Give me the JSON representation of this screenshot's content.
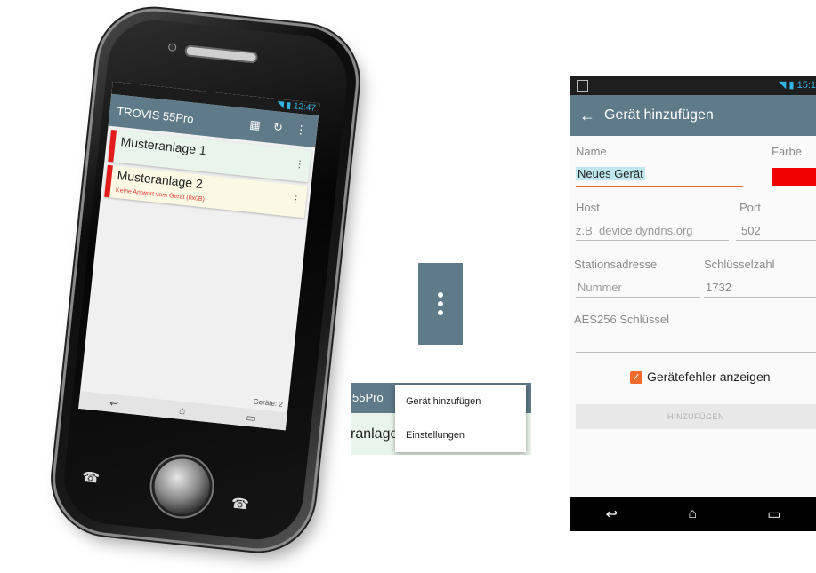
{
  "phone": {
    "status_time": "12:47",
    "app_title": "TROVIS 55Pro",
    "devices": [
      {
        "name": "Musteranlage 1",
        "error": "",
        "bg": "#e9f5ea"
      },
      {
        "name": "Musteranlage 2",
        "error": "Keine Antwort vom Gerät (0x0B)",
        "bg": "#fbf9e4"
      }
    ],
    "device_count": "Geräte: 2"
  },
  "menu_crop": {
    "app_title_fragment": "55Pro",
    "card_fragment": "ranlage",
    "items": [
      "Gerät hinzufügen",
      "Einstellungen"
    ]
  },
  "add_device": {
    "status_time": "15:1",
    "title": "Gerät hinzufügen",
    "name_label": "Name",
    "name_value": "Neues Gerät",
    "color_label": "Farbe",
    "color_value": "#f00000",
    "host_label": "Host",
    "host_placeholder": "z.B. device.dyndns.org",
    "port_label": "Port",
    "port_value": "502",
    "station_label": "Stationsadresse",
    "station_placeholder": "Nummer",
    "key_number_label": "Schlüsselzahl",
    "key_number_value": "1732",
    "aes_label": "AES256 Schlüssel",
    "aes_value": "",
    "checkbox_label": "Gerätefehler anzeigen",
    "checkbox_checked": true,
    "submit_label": "HINZUFÜGEN"
  },
  "colors": {
    "app_bar": "#5f7a88",
    "accent": "#f06a2c",
    "stripe": "#e31b1b"
  }
}
